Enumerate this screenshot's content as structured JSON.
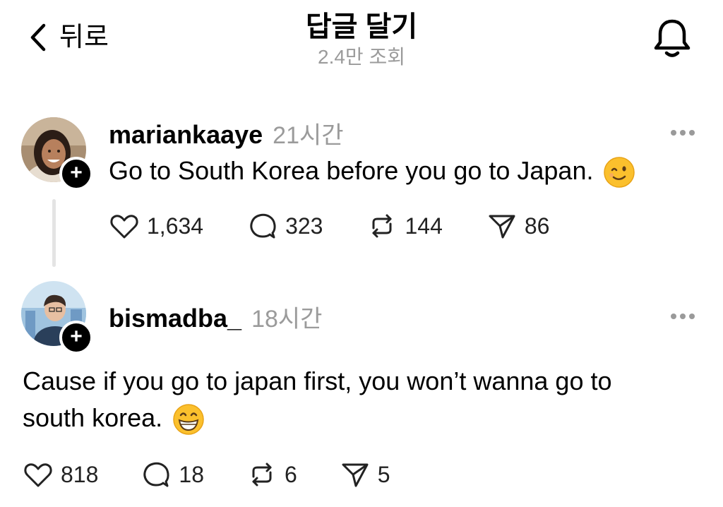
{
  "header": {
    "back_label": "뒤로",
    "title": "답글 달기",
    "subtitle": "2.4만 조회"
  },
  "posts": [
    {
      "username": "mariankaaye",
      "time": "21시간",
      "text": "Go to South Korea before you go to Japan.",
      "emoji": "winking-face-emoji",
      "actions": {
        "likes": "1,634",
        "comments": "323",
        "reposts": "144",
        "shares": "86"
      }
    },
    {
      "username": "bismadba_",
      "time": "18시간",
      "text_line1": "Cause if you go to japan first, you won’t wanna go to",
      "text_line2": "south korea.",
      "emoji": "grinning-face-emoji",
      "actions": {
        "likes": "818",
        "comments": "18",
        "reposts": "6",
        "shares": "5"
      }
    }
  ],
  "icons": [
    "chevron-left-icon",
    "bell-icon",
    "heart-icon",
    "comment-icon",
    "repost-icon",
    "share-icon",
    "more-icon",
    "plus-icon"
  ]
}
